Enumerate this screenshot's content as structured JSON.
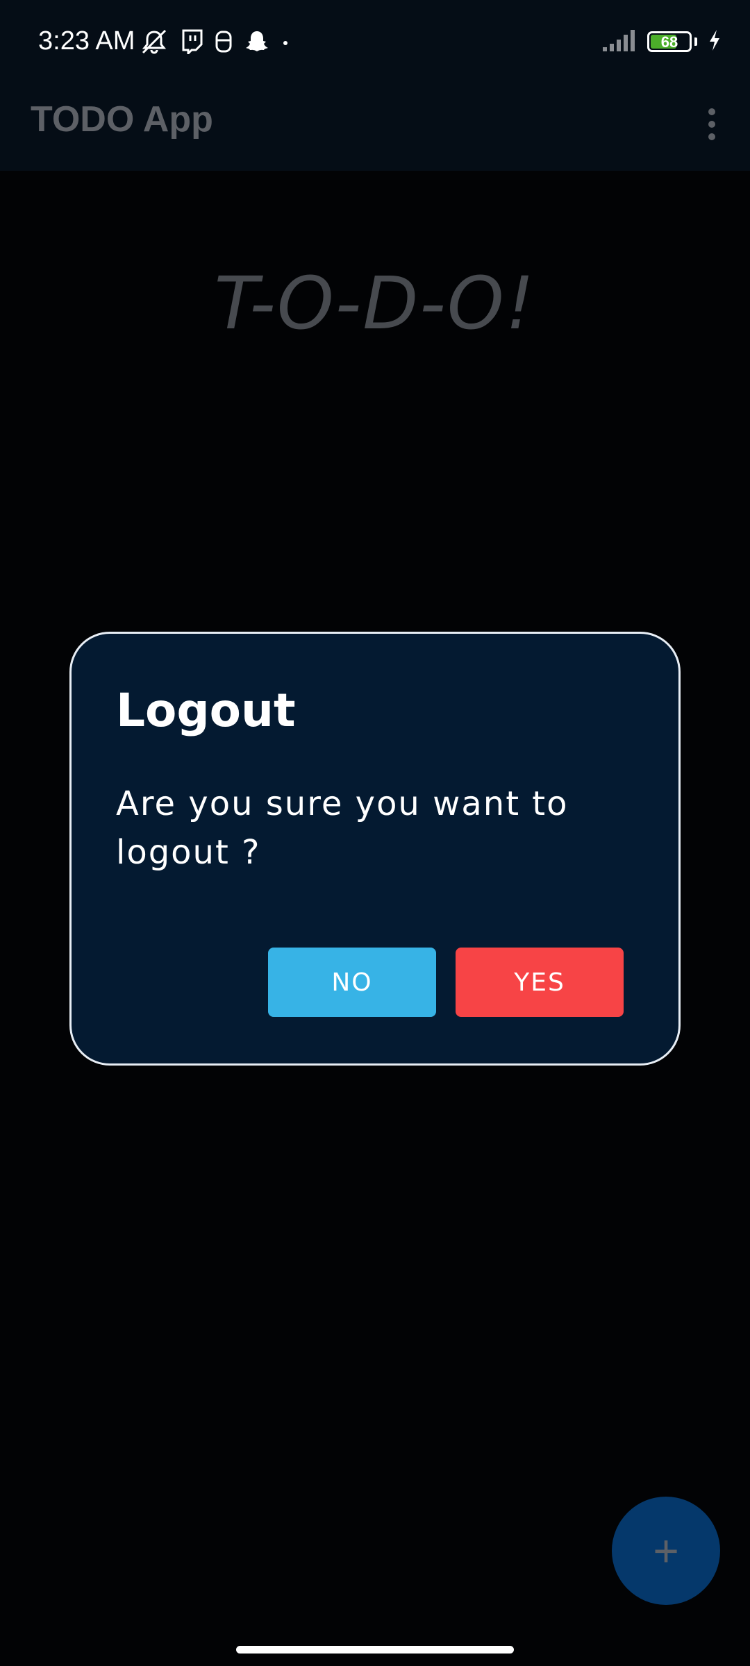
{
  "status_bar": {
    "time": "3:23 AM",
    "left_icons": [
      "bell-off-icon",
      "twitch-icon",
      "sim-tool-icon",
      "snapchat-icon",
      "dot-icon"
    ],
    "right_icons": [
      "signal-icon",
      "battery-icon",
      "charging-icon"
    ],
    "battery_level": "68",
    "battery_fraction": 0.68,
    "battery_color": "#4caf2a"
  },
  "app_bar": {
    "title": "TODO App",
    "menu_icon": "more-vert-icon"
  },
  "main": {
    "logo_text": "T-O-D-O!"
  },
  "dialog": {
    "title": "Logout",
    "message": "Are you sure you want to logout ?",
    "no_label": "NO",
    "yes_label": "YES",
    "no_color": "#37b3e6",
    "yes_color": "#f74446"
  },
  "fab": {
    "icon": "plus-icon",
    "symbol": "+"
  }
}
